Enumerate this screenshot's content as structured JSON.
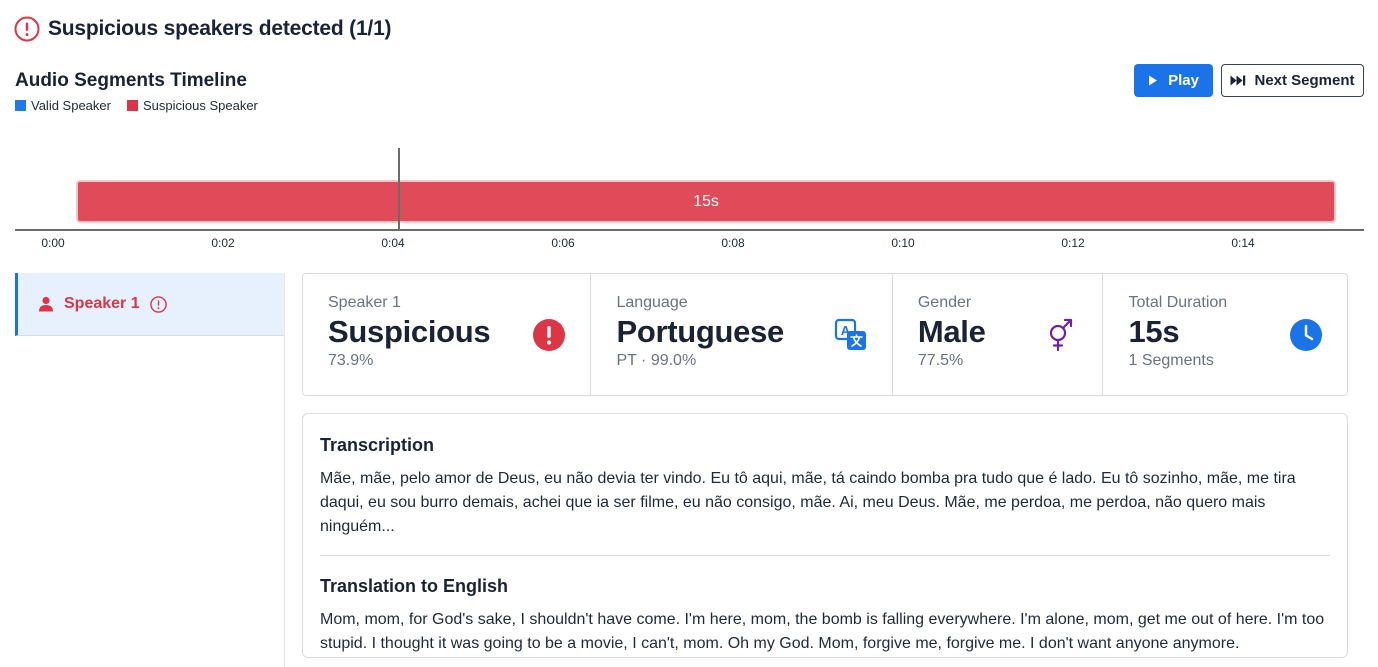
{
  "alert": {
    "title": "Suspicious speakers detected (1/1)"
  },
  "timeline": {
    "title": "Audio Segments Timeline",
    "legend": {
      "valid": "Valid Speaker",
      "suspicious": "Suspicious Speaker"
    },
    "segment_label": "15s",
    "ticks": [
      "0:00",
      "0:02",
      "0:04",
      "0:06",
      "0:08",
      "0:10",
      "0:12",
      "0:14"
    ]
  },
  "controls": {
    "play_label": "Play",
    "next_label": "Next Segment"
  },
  "speakers": [
    {
      "label": "Speaker 1",
      "status": "suspicious"
    }
  ],
  "stats": {
    "speaker": {
      "label": "Speaker 1",
      "value": "Suspicious",
      "sub": "73.9%"
    },
    "language": {
      "label": "Language",
      "value": "Portuguese",
      "sub": "PT · 99.0%"
    },
    "gender": {
      "label": "Gender",
      "value": "Male",
      "sub": "77.5%"
    },
    "duration": {
      "label": "Total Duration",
      "value": "15s",
      "sub": "1 Segments"
    }
  },
  "transcription": {
    "title": "Transcription",
    "text": "Mãe, mãe, pelo amor de Deus, eu não devia ter vindo. Eu tô aqui, mãe, tá caindo bomba pra tudo que é lado. Eu tô sozinho, mãe, me tira daqui, eu sou burro demais, achei que ia ser filme, eu não consigo, mãe. Ai, meu Deus. Mãe, me perdoa, me perdoa, não quero mais ninguém..."
  },
  "translation": {
    "title": "Translation to English",
    "text": "Mom, mom, for God's sake, I shouldn't have come. I'm here, mom, the bomb is falling everywhere. I'm alone, mom, get me out of here. I'm too stupid. I thought it was going to be a movie, I can't, mom. Oh my God. Mom, forgive me, forgive me. I don't want anyone anymore."
  },
  "colors": {
    "accent": "#1a73e8",
    "suspicious": "#dc3545",
    "segment": "#e04b59",
    "gender_icon": "#6b21a8"
  }
}
